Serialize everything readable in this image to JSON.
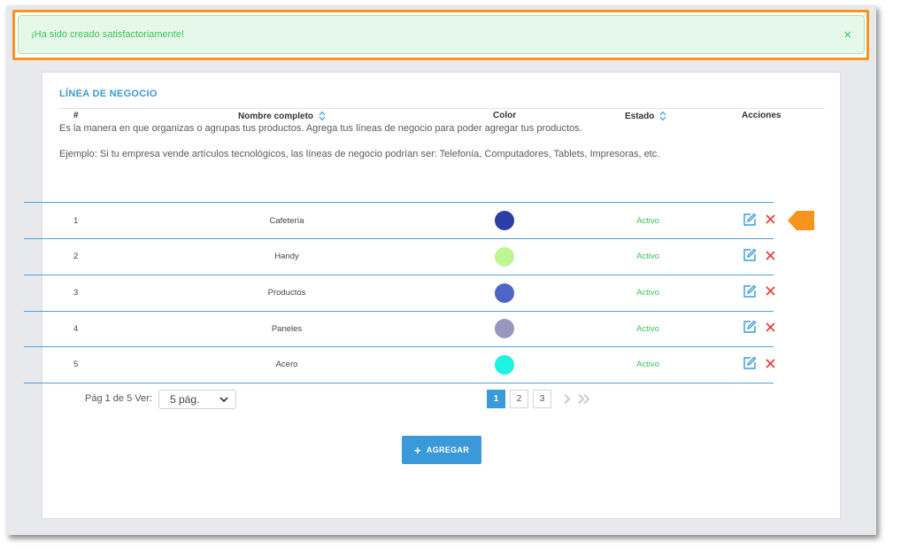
{
  "alert": {
    "message": "¡Ha sido creado satisfactoriamente!",
    "close_glyph": "×"
  },
  "card": {
    "title": "LÍNEA DE NEGOCIO",
    "description": "Es la manera en que organizas o agrupas tus productos. Agrega tus líneas de negocio para poder agregar tus productos.",
    "example": "Ejemplo: Si tu empresa vende artículos tecnológicos, las líneas de negocio podrían ser: Telefonía, Computadores, Tablets, Impresoras, etc."
  },
  "table": {
    "headers": {
      "num": "#",
      "name": "Nombre completo",
      "color": "Color",
      "status": "Estado",
      "actions": "Acciones"
    },
    "rows": [
      {
        "num": "1",
        "name": "Cafetería",
        "color": "#2b3ea3",
        "status": "Activo"
      },
      {
        "num": "2",
        "name": "Handy",
        "color": "#bff592",
        "status": "Activo"
      },
      {
        "num": "3",
        "name": "Productos",
        "color": "#4d66c6",
        "status": "Activo"
      },
      {
        "num": "4",
        "name": "Paneles",
        "color": "#9b96be",
        "status": "Activo"
      },
      {
        "num": "5",
        "name": "Acero",
        "color": "#1ef3e3",
        "status": "Activo"
      }
    ]
  },
  "pagination": {
    "info": "Pág 1 de 5 Ver:",
    "per_page": "5 pág.",
    "pages": [
      "1",
      "2",
      "3"
    ],
    "current": "1"
  },
  "add_button": {
    "label": "AGREGAR"
  },
  "colors": {
    "accent": "#3a9ad9",
    "success": "#3ec35a",
    "delete": "#e8413e",
    "highlight": "#f7941d"
  }
}
